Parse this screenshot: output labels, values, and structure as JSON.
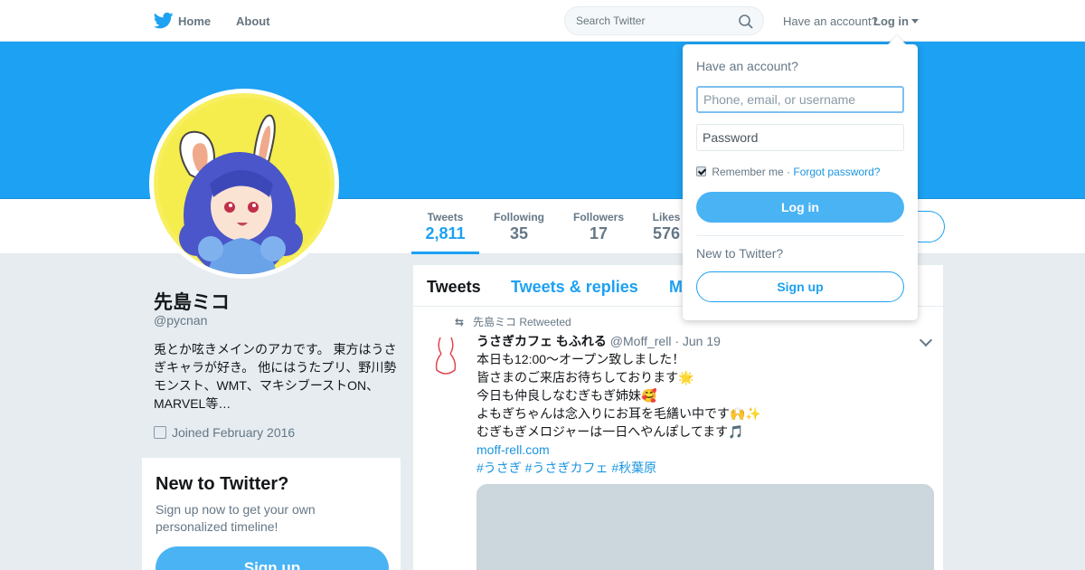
{
  "topnav": {
    "home": "Home",
    "about": "About",
    "search_placeholder": "Search Twitter",
    "have_account": "Have an account?",
    "login": "Log in"
  },
  "profile": {
    "name": "先島ミコ",
    "handle": "@pycnan",
    "bio": "兎とか呟きメインのアカです。 東方はうさぎキャラが好き。 他にはうたプリ、野川勢 モンスト、WMT、マキシブーストON、MARVEL等…",
    "joined": "Joined February 2016",
    "banner_color": "#1da1f2"
  },
  "stats": [
    {
      "label": "Tweets",
      "value": "2,811"
    },
    {
      "label": "Following",
      "value": "35"
    },
    {
      "label": "Followers",
      "value": "17"
    },
    {
      "label": "Likes",
      "value": "576"
    }
  ],
  "new_card": {
    "title": "New to Twitter?",
    "text": "Sign up now to get your own personalized timeline!",
    "button": "Sign up"
  },
  "timeline": {
    "tabs": [
      "Tweets",
      "Tweets & replies",
      "M"
    ],
    "retweet_by": "先島ミコ Retweeted",
    "tweet": {
      "author": "うさぎカフェ もふれる",
      "handle": "@Moff_rell",
      "date": "· Jun 19",
      "lines": [
        "本日も12:00～オープン致しました！",
        "皆さまのご来店お待ちしております🌟",
        "今日も仲良しなむぎもぎ姉妹🥰",
        "よもぎちゃんは念入りにお耳を毛繕い中です🙌✨",
        "むぎもぎメロジャーは一日へやんぽしてます🎵"
      ],
      "link": "moff-rell.com",
      "hashtags": "#うさぎ #うさぎカフェ #秋葉原"
    }
  },
  "login_dropdown": {
    "title": "Have an account?",
    "username_placeholder": "Phone, email, or username",
    "password_placeholder": "Password",
    "remember": "Remember me",
    "separator": " · ",
    "forgot": "Forgot password?",
    "login_button": "Log in",
    "new_to_twitter": "New to Twitter?",
    "signup_button": "Sign up"
  }
}
